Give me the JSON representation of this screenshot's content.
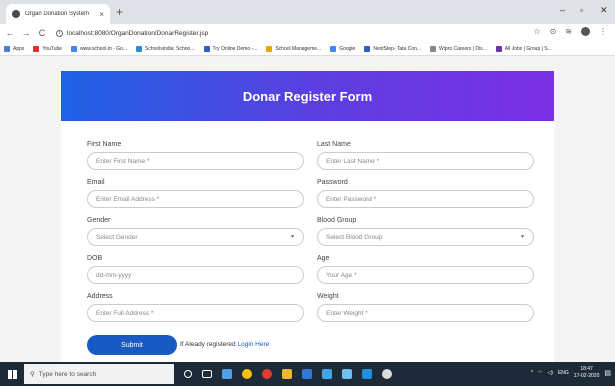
{
  "browser": {
    "tab_title": "Organ Donation System",
    "tab_close": "×",
    "new_tab": "+",
    "minimize": "–",
    "maximize": "▫",
    "close": "✕",
    "back": "←",
    "forward": "→",
    "reload": "C",
    "url": "localhost:8080/OrganDonation/DonarRegister.jsp",
    "star": "☆",
    "bookmarks": [
      {
        "label": "Apps",
        "color": "#4a7bd6"
      },
      {
        "label": "YouTube",
        "color": "#e52d27"
      },
      {
        "label": "www.school.in - Go...",
        "color": "#4285f4"
      },
      {
        "label": "Schoolsindia: Schoo...",
        "color": "#2b8ad6"
      },
      {
        "label": "Try Online Demo -...",
        "color": "#2f5fb8"
      },
      {
        "label": "School Manageme...",
        "color": "#e0a800"
      },
      {
        "label": "Google",
        "color": "#4285f4"
      },
      {
        "label": "NextStep- Tata Con...",
        "color": "#2f5fb8"
      },
      {
        "label": "Wipro Careers | Dis...",
        "color": "#888888"
      },
      {
        "label": "All Jobs | Group | S...",
        "color": "#6b2fb8"
      }
    ]
  },
  "form": {
    "title": "Donar Register Form",
    "fields": {
      "first_name": {
        "label": "First Name",
        "placeholder": "Enter First Name *"
      },
      "last_name": {
        "label": "Last Name",
        "placeholder": "Enter Last Name *"
      },
      "email": {
        "label": "Email",
        "placeholder": "Enter Email Address *"
      },
      "password": {
        "label": "Password",
        "placeholder": "Enter Password *"
      },
      "gender": {
        "label": "Gender",
        "value": "Select Gender"
      },
      "blood_group": {
        "label": "Blood Group",
        "value": "Select Blood Group"
      },
      "dob": {
        "label": "DOB",
        "placeholder": "dd-mm-yyyy"
      },
      "age": {
        "label": "Age",
        "placeholder": "Your Age *"
      },
      "address": {
        "label": "Address",
        "placeholder": "Enter Full Address *"
      },
      "weight": {
        "label": "Weight",
        "placeholder": "Enter Weight *"
      }
    },
    "submit_label": "Submit",
    "login_prompt": "If Aleady registered",
    "login_link": "Login Here",
    "caret": "▼"
  },
  "taskbar": {
    "search_placeholder": "Type here to search",
    "tray_lang": "ENG",
    "time": "18:47",
    "date": "17-02-2020"
  }
}
